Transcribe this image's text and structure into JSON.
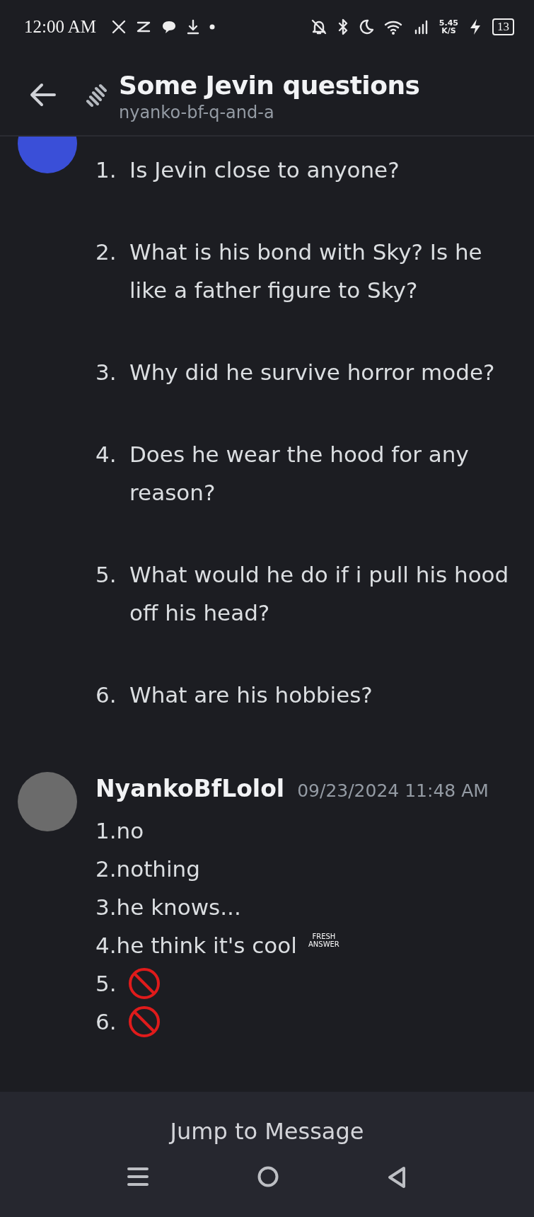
{
  "status_bar": {
    "time": "12:00 AM",
    "speed": "5.45",
    "speed_unit": "K/S",
    "battery": "13"
  },
  "header": {
    "title": "Some Jevin questions",
    "subtitle": "nyanko-bf-q-and-a"
  },
  "messages": [
    {
      "lines": [
        {
          "number": "1.",
          "text": "Is Jevin close to anyone?"
        },
        {
          "number": "2.",
          "text": "What is his bond with Sky? Is he like a father figure to Sky?"
        },
        {
          "number": "3.",
          "text": "Why did he survive horror mode?"
        },
        {
          "number": "4.",
          "text": "Does he wear the hood for any reason?"
        },
        {
          "number": "5.",
          "text": "What would he do if i pull his hood off his head?"
        },
        {
          "number": "6.",
          "text": "What are his hobbies?"
        }
      ]
    },
    {
      "author": "NyankoBfLolol",
      "timestamp": "09/23/2024 11:48 AM",
      "lines": [
        {
          "text": "1.no"
        },
        {
          "text": "2.nothing"
        },
        {
          "text": "3.he knows..."
        },
        {
          "text": "4.he think it's cool",
          "emoji": {
            "kind": "fresh",
            "text": "FRESH ANSWER"
          }
        },
        {
          "text": "5.",
          "emoji": {
            "kind": "no"
          }
        },
        {
          "text": "6.",
          "emoji": {
            "kind": "no"
          }
        }
      ]
    }
  ],
  "jump_button": "Jump to Message"
}
